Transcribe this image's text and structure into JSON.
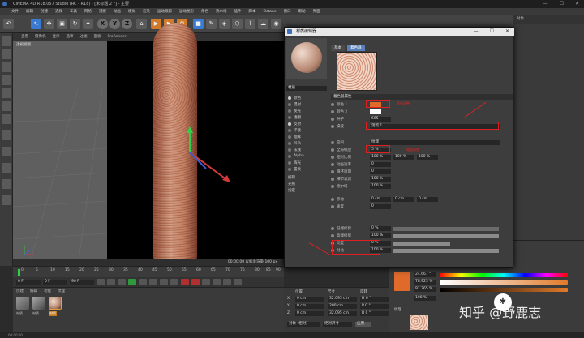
{
  "window": {
    "title": "CINEMA 4D R18.057 Studio (RC - R18) - [未标题 2 *] - 主要",
    "controls": [
      "—",
      "☐",
      "✕"
    ]
  },
  "menu": [
    "文件",
    "编辑",
    "创建",
    "选择",
    "工具",
    "网格",
    "捕捉",
    "动画",
    "模拟",
    "渲染",
    "运动跟踪",
    "运动图形",
    "角色",
    "流水线",
    "插件",
    "脚本",
    "Octane",
    "窗口",
    "帮助",
    "界面"
  ],
  "toolbar": {
    "axes": [
      "X",
      "Y",
      "Z"
    ]
  },
  "viewport": {
    "menu": [
      "查看",
      "摄像机",
      "显示",
      "选项",
      "过滤",
      "面板",
      "ProRender"
    ],
    "label": "透视视图",
    "render_status": "00:00:00 以标准渲染 100 px"
  },
  "timeline": {
    "ticks": [
      "0",
      "5",
      "10",
      "15",
      "20",
      "25",
      "30",
      "35",
      "40",
      "45",
      "50",
      "55",
      "60",
      "65",
      "70",
      "75",
      "80",
      "85",
      "90"
    ],
    "start_frame": "0 F",
    "end_frame": "90 F",
    "current": "0 F"
  },
  "materials": {
    "menu": [
      "创建",
      "编辑",
      "功能",
      "纹理"
    ],
    "thumbs": [
      {
        "name": "材质"
      },
      {
        "name": "材质"
      },
      {
        "name": "材质"
      }
    ]
  },
  "coords": {
    "headers": [
      "位置",
      "尺寸",
      "旋转"
    ],
    "rows": [
      {
        "axis": "X",
        "pos": "0 cm",
        "size": "32.095 cm",
        "rot": "H 0 °"
      },
      {
        "axis": "Y",
        "pos": "0 cm",
        "size": "200 cm",
        "rot": "P 0 °"
      },
      {
        "axis": "Z",
        "pos": "0 cm",
        "size": "32.095 cm",
        "rot": "B 0 °"
      }
    ],
    "mode": "对象 (相对)",
    "size_mode": "绝对尺寸",
    "apply": "应用"
  },
  "statusbar": "00:00:00",
  "matedit": {
    "title": "材质编辑器",
    "controls": [
      "—",
      "☐",
      "✕"
    ],
    "name": "材质",
    "tabs": [
      "基本",
      "着色器"
    ],
    "section": "着色器属性",
    "channels": [
      {
        "label": "颜色",
        "on": true
      },
      {
        "label": "漫射",
        "on": false
      },
      {
        "label": "发光",
        "on": false
      },
      {
        "label": "透明",
        "on": false
      },
      {
        "label": "反射",
        "on": true
      },
      {
        "label": "环境",
        "on": false
      },
      {
        "label": "烟雾",
        "on": false
      },
      {
        "label": "凹凸",
        "on": false
      },
      {
        "label": "法线",
        "on": false
      },
      {
        "label": "Alpha",
        "on": false
      },
      {
        "label": "辉光",
        "on": false
      },
      {
        "label": "置换",
        "on": false
      },
      {
        "label": "编辑",
        "on": false
      },
      {
        "label": "光照",
        "on": false
      },
      {
        "label": "指定",
        "on": false
      }
    ],
    "params": [
      {
        "label": "颜色 1",
        "value": ""
      },
      {
        "label": "颜色 2",
        "value": ""
      },
      {
        "label": "种子",
        "value": "665"
      },
      {
        "label": "噪波",
        "value": "湍流 1"
      },
      {
        "label": "空间",
        "value": "纹理"
      },
      {
        "label": "全局缩放",
        "value": "5 %"
      },
      {
        "label": "相对比例",
        "value": "100 %"
      },
      {
        "label": "动画速率",
        "value": "0"
      },
      {
        "label": "循环周期",
        "value": "0"
      },
      {
        "label": "细节衰减",
        "value": "100 %"
      },
      {
        "label": "德尔塔",
        "value": "100 %"
      },
      {
        "label": "移动",
        "value": "0 cm"
      },
      {
        "label": "速度",
        "value": "0"
      },
      {
        "label": "低端修剪",
        "value": "0 %"
      },
      {
        "label": "高端修剪",
        "value": "100 %"
      },
      {
        "label": "亮度",
        "value": "0 %"
      },
      {
        "label": "对比",
        "value": "100 %"
      }
    ],
    "annotations": [
      "颜色调整",
      "缩放调整"
    ]
  },
  "right": {
    "header": "对象",
    "color_values": [
      "24.667 °",
      "78.923 %",
      "91.765 %"
    ],
    "brightness": "100 %",
    "layer": "纹理"
  },
  "watermark": "知乎 @野鹿志",
  "accent": {
    "highlight": "#e02020",
    "color1": "#e06a2a",
    "tab": "#5a7fb8"
  }
}
